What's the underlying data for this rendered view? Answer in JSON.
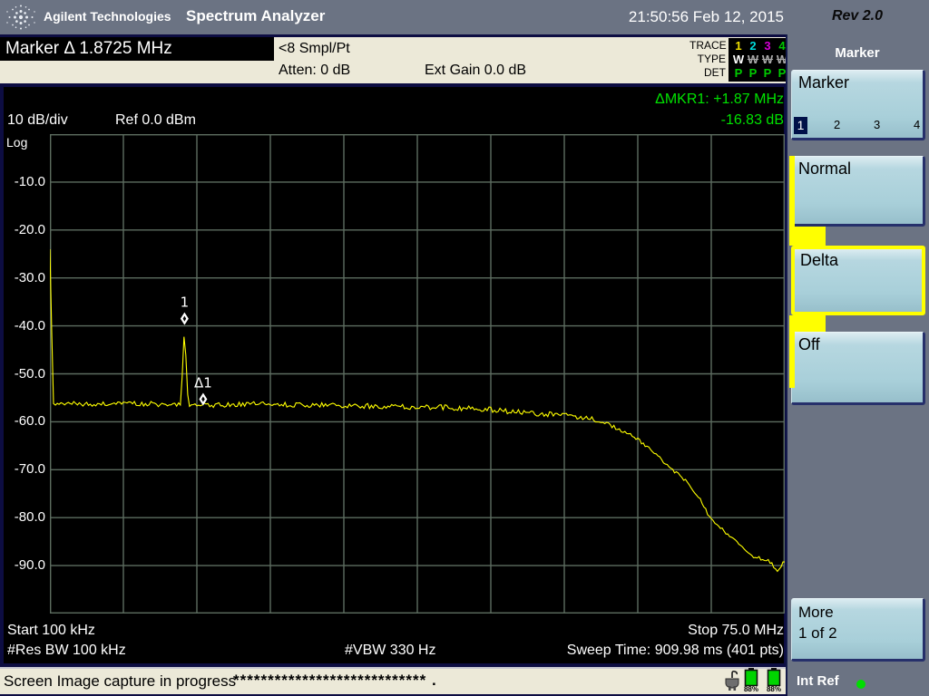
{
  "titlebar": {
    "brand": "Agilent Technologies",
    "app_title": "Spectrum Analyzer",
    "datetime": "21:50:56  Feb 12, 2015",
    "rev": "Rev 2.0"
  },
  "header": {
    "active_function": "Marker Δ 1.8725 MHz",
    "sampling": "<8 Smpl/Pt",
    "atten": "Atten: 0 dB",
    "ext_gain": "Ext Gain 0.0 dB",
    "trace_table": {
      "row_labels": [
        "TRACE",
        "TYPE",
        "DET"
      ],
      "trace_numbers": [
        "1",
        "2",
        "3",
        "4"
      ],
      "trace_colors": [
        "#f0e000",
        "#00dcdc",
        "#d800d8",
        "#00c800"
      ],
      "types": [
        "W",
        "W",
        "W",
        "W"
      ],
      "type_active": [
        true,
        false,
        false,
        false
      ],
      "dets": [
        "P",
        "P",
        "P",
        "P"
      ],
      "det_color": "#00cc00"
    }
  },
  "display": {
    "scale_label": "10 dB/div",
    "ref_label": "Ref 0.0 dBm",
    "log_label": "Log",
    "delta_readout_line1": "ΔMKR1: +1.87 MHz",
    "delta_readout_line2": "-16.83 dB",
    "start_label": "Start 100 kHz",
    "stop_label": "Stop 75.0 MHz",
    "rbw_label": "#Res BW 100 kHz",
    "vbw_label": "#VBW 330 Hz",
    "sweep_label": "Sweep Time: 909.98 ms (401 pts)"
  },
  "chart_data": {
    "type": "line",
    "title": "Spectrum analyzer trace 1",
    "x_unit": "MHz",
    "y_unit": "dBm",
    "x_range": [
      0.1,
      75.0
    ],
    "y_range": [
      -100,
      0
    ],
    "ref_level_dbm": 0.0,
    "scale_db_per_div": 10,
    "y_ticks": [
      "-10.0",
      "-20.0",
      "-30.0",
      "-40.0",
      "-50.0",
      "-60.0",
      "-70.0",
      "-80.0",
      "-90.0"
    ],
    "grid": {
      "cols": 10,
      "rows": 10,
      "color": "#5d6d60"
    },
    "trace_color": "#ffff00",
    "sweep_points": 401,
    "noise": {
      "seed": 20150212,
      "amp_db": 0.55,
      "amp_db_rolloff": 0.35,
      "rolloff_start_mhz": 56,
      "exclude_below_mhz": 0.6,
      "exclude_near_peak_mhz": 0.6
    },
    "anchors": [
      [
        0.1,
        -24.0
      ],
      [
        0.45,
        -56.2
      ],
      [
        5,
        -56.3
      ],
      [
        10,
        -56.2
      ],
      [
        13.45,
        -56.5
      ],
      [
        13.82,
        -40.0
      ],
      [
        14.2,
        -56.8
      ],
      [
        20,
        -56.3
      ],
      [
        25,
        -56.5
      ],
      [
        30,
        -56.6
      ],
      [
        35,
        -56.8
      ],
      [
        40,
        -57.0
      ],
      [
        44,
        -57.3
      ],
      [
        48,
        -58.0
      ],
      [
        52,
        -58.6
      ],
      [
        55,
        -59.2
      ],
      [
        56.5,
        -60.0
      ],
      [
        58,
        -61.5
      ],
      [
        59.7,
        -63.2
      ],
      [
        61.5,
        -66.0
      ],
      [
        63.1,
        -69.3
      ],
      [
        65.2,
        -72.7
      ],
      [
        66.3,
        -76.0
      ],
      [
        67.3,
        -79.7
      ],
      [
        68.5,
        -82.2
      ],
      [
        69.9,
        -84.8
      ],
      [
        71.0,
        -86.6
      ],
      [
        71.9,
        -88.3
      ],
      [
        72.8,
        -88.6
      ],
      [
        73.6,
        -89.3
      ],
      [
        74.25,
        -91.2
      ],
      [
        74.6,
        -90.2
      ],
      [
        74.9,
        -89.0
      ]
    ],
    "markers": [
      {
        "label": "1",
        "f_mhz": 13.82,
        "level_db": -40.0
      },
      {
        "label": "Δ1",
        "f_mhz": 15.72,
        "level_db": -56.8
      }
    ]
  },
  "sidebar": {
    "menu_title": "Marker",
    "marker_select": {
      "label": "Marker",
      "options": [
        "1",
        "2",
        "3",
        "4"
      ],
      "selected": "1"
    },
    "normal": {
      "label": "Normal"
    },
    "delta": {
      "label": "Delta"
    },
    "off": {
      "label": "Off"
    },
    "more": {
      "line1": "More",
      "line2": "1 of 2"
    }
  },
  "statusbar": {
    "message": "Screen Image capture in progress",
    "progress": "**************************** .",
    "battery1": "88%",
    "battery2": "88%",
    "int_ref": "Int Ref"
  }
}
